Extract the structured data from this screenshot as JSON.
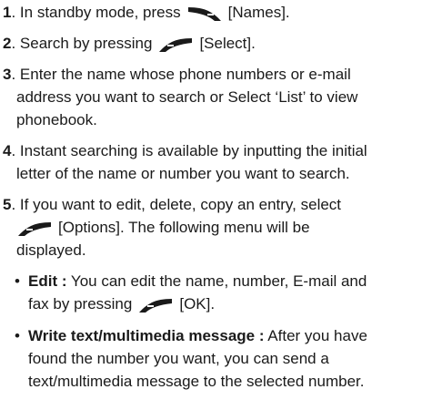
{
  "steps": [
    {
      "num": "1",
      "before": ". In standby mode, press",
      "after": "[Names].",
      "icon": "right-softkey-icon"
    },
    {
      "num": "2",
      "before": ". Search by pressing",
      "after": "[Select].",
      "icon": "left-softkey-icon"
    },
    {
      "num": "3",
      "line1": ". Enter the name whose phone numbers or e-mail",
      "line2": "address you want to search or Select ‘List’ to view",
      "line3": "phonebook."
    },
    {
      "num": "4",
      "line1": ". Instant searching is available by inputting the initial",
      "line2": "letter of the name or number you want to search."
    },
    {
      "num": "5",
      "line1": ". If you want to edit, delete, copy an entry, select",
      "line2_after": "[Options]. The following menu will be",
      "line3": "displayed.",
      "icon": "left-softkey-icon"
    }
  ],
  "bullets": [
    {
      "dot": "•",
      "label": "Edit :",
      "line1_rest": "You can edit the name, number, E-mail and",
      "line2_before": "fax by pressing",
      "line2_after": "[OK].",
      "icon": "left-softkey-icon"
    },
    {
      "dot": "•",
      "label": "Write text/multimedia message :",
      "line1_rest": "After you have",
      "line2": "found the number you want, you can send a",
      "line3": "text/multimedia message to the selected number."
    }
  ]
}
